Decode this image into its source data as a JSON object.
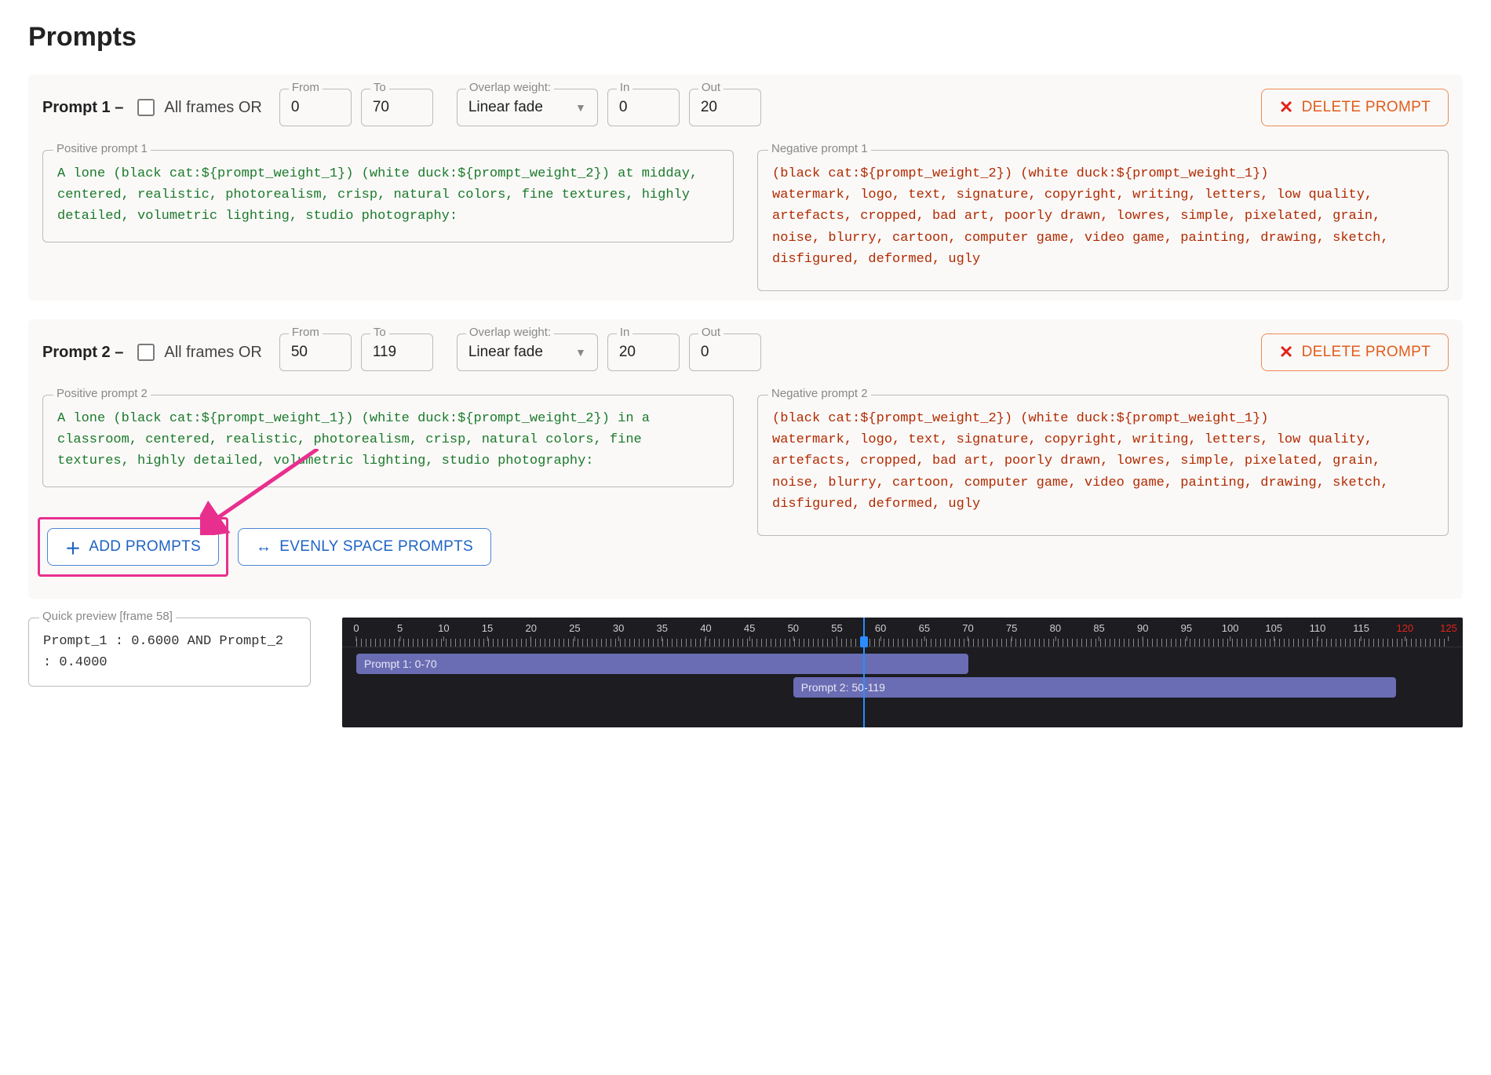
{
  "page": {
    "title": "Prompts"
  },
  "common": {
    "all_frames_or": "All frames OR",
    "delete_prompt": "DELETE PROMPT"
  },
  "labels": {
    "from": "From",
    "to": "To",
    "overlap": "Overlap weight:",
    "in": "In",
    "out": "Out",
    "positive1": "Positive prompt 1",
    "negative1": "Negative prompt 1",
    "positive2": "Positive prompt 2",
    "negative2": "Negative prompt 2",
    "overlap_mode": "Linear fade"
  },
  "prompts": [
    {
      "title": "Prompt 1 –",
      "from": "0",
      "to": "70",
      "overlap_mode": "Linear fade",
      "in": "0",
      "out": "20",
      "positive": "A lone (black cat:${prompt_weight_1}) (white duck:${prompt_weight_2}) at midday, centered, realistic, photorealism, crisp, natural colors, fine textures, highly detailed, volumetric lighting, studio photography:",
      "negative": "(black cat:${prompt_weight_2}) (white duck:${prompt_weight_1})\nwatermark, logo, text, signature, copyright, writing, letters, low quality, artefacts, cropped, bad art, poorly drawn, lowres, simple, pixelated, grain, noise, blurry, cartoon, computer game, video game, painting, drawing, sketch, disfigured, deformed, ugly"
    },
    {
      "title": "Prompt 2 –",
      "from": "50",
      "to": "119",
      "overlap_mode": "Linear fade",
      "in": "20",
      "out": "0",
      "positive": "A lone (black cat:${prompt_weight_1}) (white duck:${prompt_weight_2}) in a classroom, centered, realistic, photorealism, crisp, natural colors, fine textures, highly detailed, volumetric lighting, studio photography:",
      "negative": "(black cat:${prompt_weight_2}) (white duck:${prompt_weight_1})\nwatermark, logo, text, signature, copyright, writing, letters, low quality, artefacts, cropped, bad art, poorly drawn, lowres, simple, pixelated, grain, noise, blurry, cartoon, computer game, video game, painting, drawing, sketch, disfigured, deformed, ugly"
    }
  ],
  "toolbar": {
    "add": "ADD PROMPTS",
    "space": "EVENLY SPACE PROMPTS"
  },
  "quick_preview": {
    "legend": "Quick preview [frame 58]",
    "body": "Prompt_1 : 0.6000 AND Prompt_2 : 0.4000"
  },
  "timeline": {
    "range_max": 125,
    "ticks": [
      0,
      5,
      10,
      15,
      20,
      25,
      30,
      35,
      40,
      45,
      50,
      55,
      60,
      65,
      70,
      75,
      80,
      85,
      90,
      95,
      100,
      105,
      110,
      115,
      120,
      125
    ],
    "overflow_start": 120,
    "playhead": 58,
    "bars": [
      {
        "label": "Prompt 1: 0-70",
        "from": 0,
        "to": 70,
        "row": 0
      },
      {
        "label": "Prompt 2: 50-119",
        "from": 50,
        "to": 119,
        "row": 1
      }
    ]
  }
}
